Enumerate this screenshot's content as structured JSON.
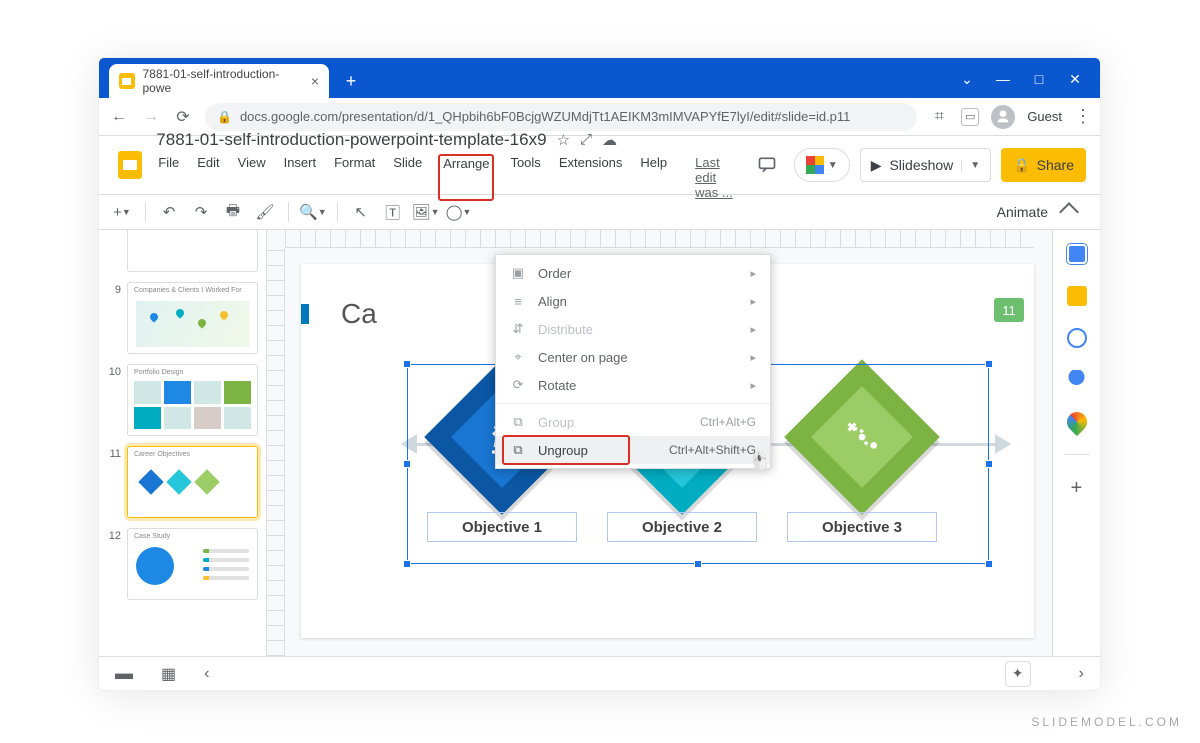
{
  "browser": {
    "tab_title": "7881-01-self-introduction-powe",
    "url": "docs.google.com/presentation/d/1_QHpbih6bF0BcjgWZUMdjTt1AEIKM3mIMVAPYfE7lyI/edit#slide=id.p11",
    "guest": "Guest"
  },
  "doc": {
    "title": "7881-01-self-introduction-powerpoint-template-16x9",
    "last_edit": "Last edit was ..."
  },
  "menus": {
    "file": "File",
    "edit": "Edit",
    "view": "View",
    "insert": "Insert",
    "format": "Format",
    "slide": "Slide",
    "arrange": "Arrange",
    "tools": "Tools",
    "extensions": "Extensions",
    "help": "Help"
  },
  "header_buttons": {
    "slideshow": "Slideshow",
    "share": "Share"
  },
  "toolbar": {
    "animate": "Animate"
  },
  "arrange_menu": {
    "order": "Order",
    "align": "Align",
    "distribute": "Distribute",
    "center": "Center on page",
    "rotate": "Rotate",
    "group": "Group",
    "group_shortcut": "Ctrl+Alt+G",
    "ungroup": "Ungroup",
    "ungroup_shortcut": "Ctrl+Alt+Shift+G"
  },
  "thumbnails": [
    {
      "num": "",
      "title": ""
    },
    {
      "num": "9",
      "title": "Companies & Clients I Worked For"
    },
    {
      "num": "10",
      "title": "Portfolio Design"
    },
    {
      "num": "11",
      "title": "Career Objectives"
    },
    {
      "num": "12",
      "title": "Case Study"
    }
  ],
  "canvas": {
    "heading_truncated": "Ca",
    "slide_number": "11",
    "objectives": [
      "Objective 1",
      "Objective 2",
      "Objective 3"
    ]
  },
  "watermark": "SLIDEMODEL.COM"
}
